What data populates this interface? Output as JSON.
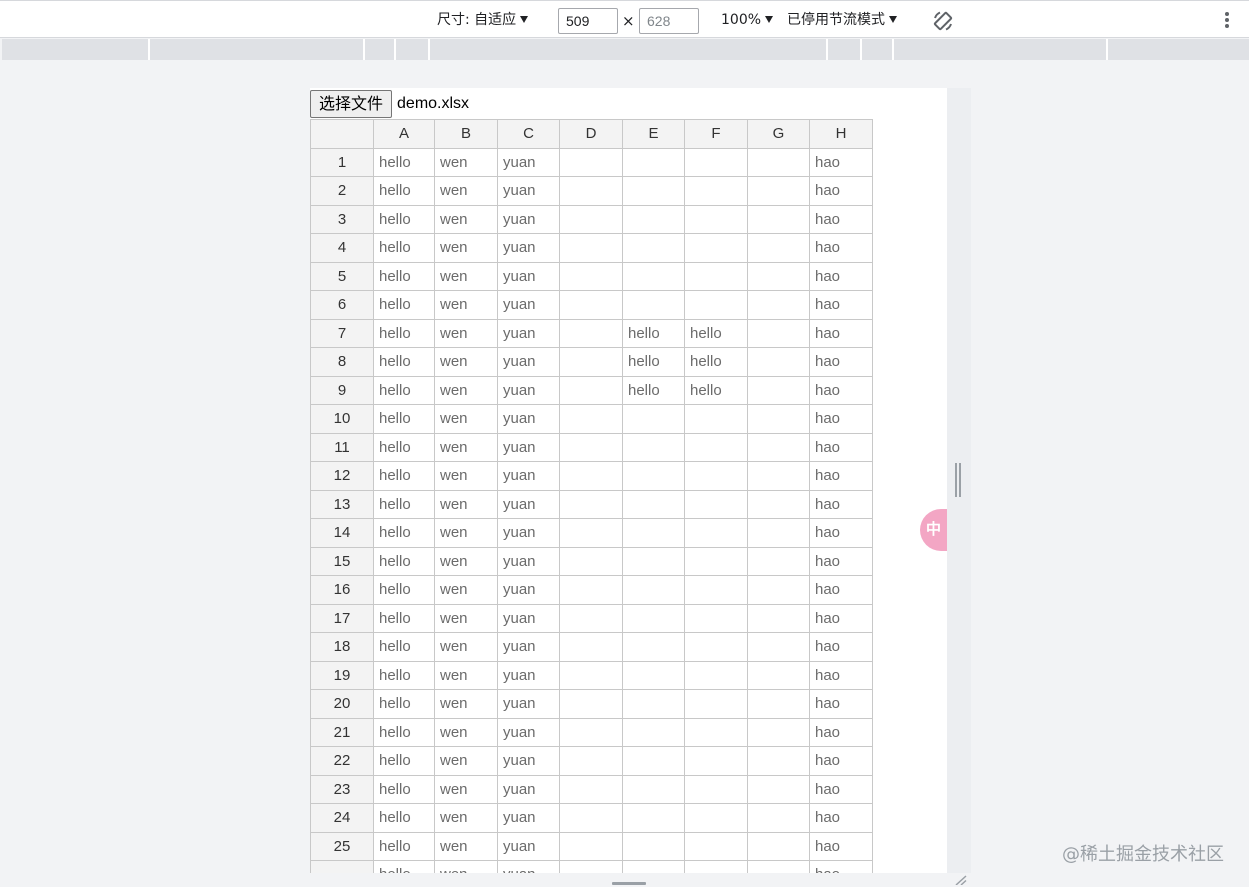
{
  "devtools": {
    "size_label": "尺寸: 自适应",
    "width_value": "509",
    "height_value": "628",
    "times": "×",
    "zoom_label": "100%",
    "throttle_label": "已停用节流模式"
  },
  "page": {
    "choose_file_label": "选择文件",
    "file_name": "demo.xlsx"
  },
  "sheet": {
    "columns": [
      "A",
      "B",
      "C",
      "D",
      "E",
      "F",
      "G",
      "H"
    ],
    "rows": [
      {
        "n": "1",
        "cells": [
          "hello",
          "wen",
          "yuan",
          "",
          "",
          "",
          "",
          "hao"
        ]
      },
      {
        "n": "2",
        "cells": [
          "hello",
          "wen",
          "yuan",
          "",
          "",
          "",
          "",
          "hao"
        ]
      },
      {
        "n": "3",
        "cells": [
          "hello",
          "wen",
          "yuan",
          "",
          "",
          "",
          "",
          "hao"
        ]
      },
      {
        "n": "4",
        "cells": [
          "hello",
          "wen",
          "yuan",
          "",
          "",
          "",
          "",
          "hao"
        ]
      },
      {
        "n": "5",
        "cells": [
          "hello",
          "wen",
          "yuan",
          "",
          "",
          "",
          "",
          "hao"
        ]
      },
      {
        "n": "6",
        "cells": [
          "hello",
          "wen",
          "yuan",
          "",
          "",
          "",
          "",
          "hao"
        ]
      },
      {
        "n": "7",
        "cells": [
          "hello",
          "wen",
          "yuan",
          "",
          "hello",
          "hello",
          "",
          "hao"
        ]
      },
      {
        "n": "8",
        "cells": [
          "hello",
          "wen",
          "yuan",
          "",
          "hello",
          "hello",
          "",
          "hao"
        ]
      },
      {
        "n": "9",
        "cells": [
          "hello",
          "wen",
          "yuan",
          "",
          "hello",
          "hello",
          "",
          "hao"
        ]
      },
      {
        "n": "10",
        "cells": [
          "hello",
          "wen",
          "yuan",
          "",
          "",
          "",
          "",
          "hao"
        ]
      },
      {
        "n": "11",
        "cells": [
          "hello",
          "wen",
          "yuan",
          "",
          "",
          "",
          "",
          "hao"
        ]
      },
      {
        "n": "12",
        "cells": [
          "hello",
          "wen",
          "yuan",
          "",
          "",
          "",
          "",
          "hao"
        ]
      },
      {
        "n": "13",
        "cells": [
          "hello",
          "wen",
          "yuan",
          "",
          "",
          "",
          "",
          "hao"
        ]
      },
      {
        "n": "14",
        "cells": [
          "hello",
          "wen",
          "yuan",
          "",
          "",
          "",
          "",
          "hao"
        ]
      },
      {
        "n": "15",
        "cells": [
          "hello",
          "wen",
          "yuan",
          "",
          "",
          "",
          "",
          "hao"
        ]
      },
      {
        "n": "16",
        "cells": [
          "hello",
          "wen",
          "yuan",
          "",
          "",
          "",
          "",
          "hao"
        ]
      },
      {
        "n": "17",
        "cells": [
          "hello",
          "wen",
          "yuan",
          "",
          "",
          "",
          "",
          "hao"
        ]
      },
      {
        "n": "18",
        "cells": [
          "hello",
          "wen",
          "yuan",
          "",
          "",
          "",
          "",
          "hao"
        ]
      },
      {
        "n": "19",
        "cells": [
          "hello",
          "wen",
          "yuan",
          "",
          "",
          "",
          "",
          "hao"
        ]
      },
      {
        "n": "20",
        "cells": [
          "hello",
          "wen",
          "yuan",
          "",
          "",
          "",
          "",
          "hao"
        ]
      },
      {
        "n": "21",
        "cells": [
          "hello",
          "wen",
          "yuan",
          "",
          "",
          "",
          "",
          "hao"
        ]
      },
      {
        "n": "22",
        "cells": [
          "hello",
          "wen",
          "yuan",
          "",
          "",
          "",
          "",
          "hao"
        ]
      },
      {
        "n": "23",
        "cells": [
          "hello",
          "wen",
          "yuan",
          "",
          "",
          "",
          "",
          "hao"
        ]
      },
      {
        "n": "24",
        "cells": [
          "hello",
          "wen",
          "yuan",
          "",
          "",
          "",
          "",
          "hao"
        ]
      },
      {
        "n": "25",
        "cells": [
          "hello",
          "wen",
          "yuan",
          "",
          "",
          "",
          "",
          "hao"
        ]
      },
      {
        "n": "",
        "cells": [
          "hello",
          "wen",
          "yuan",
          "",
          "",
          "",
          "",
          "hao"
        ]
      }
    ]
  },
  "ime_badge": "中",
  "watermark": "@稀土掘金技术社区",
  "icons": {
    "rotate": "rotate-icon",
    "more": "kebab-icon",
    "caret": "caret-down-icon"
  },
  "colors": {
    "header_bg": "#f3f3f3",
    "grid_border": "#c8c8c8",
    "cell_text": "#6b6b6b",
    "ime_badge": "#f3a6c4"
  }
}
